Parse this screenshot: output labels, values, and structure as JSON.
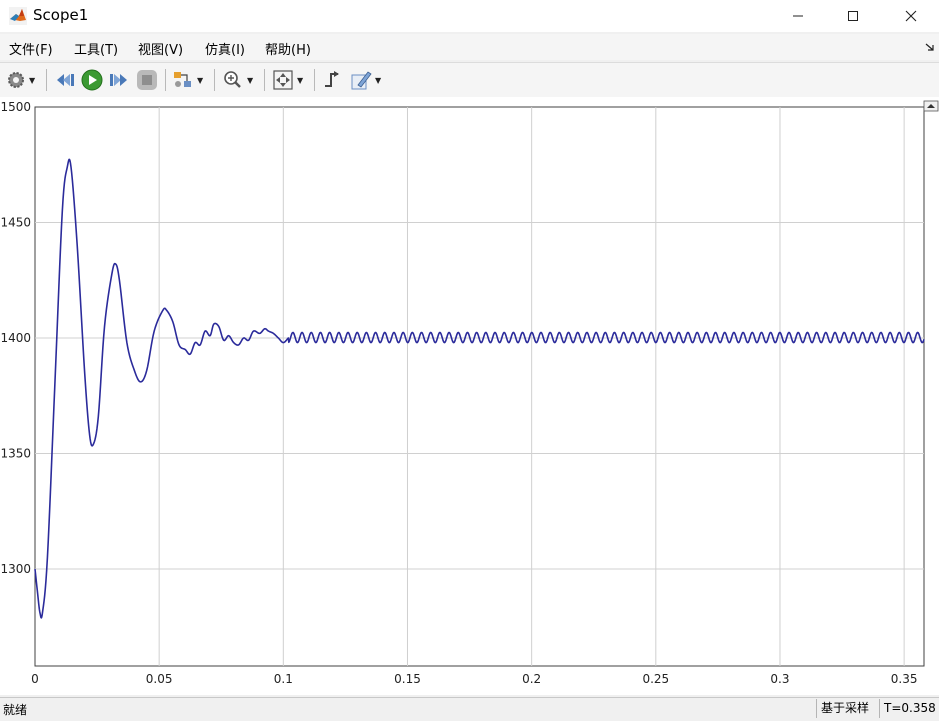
{
  "window": {
    "title": "Scope1"
  },
  "menu": {
    "items": [
      {
        "label": "文件(F)"
      },
      {
        "label": "工具(T)"
      },
      {
        "label": "视图(V)"
      },
      {
        "label": "仿真(I)"
      },
      {
        "label": "帮助(H)"
      }
    ]
  },
  "toolbar": {
    "icons": [
      "gear-icon",
      "step-back-icon",
      "run-icon",
      "step-forward-icon",
      "stop-icon",
      "signal-select-icon",
      "zoom-in-icon",
      "autoscale-icon",
      "triggers-icon",
      "style-icon"
    ]
  },
  "status": {
    "text": "就绪",
    "mode": "基于采样",
    "time": "T=0.358"
  },
  "colors": {
    "trace": "#2b2b9b",
    "grid": "#d0d0d0",
    "axes_bg": "#ffffff"
  },
  "chart_data": {
    "type": "line",
    "title": "",
    "xlabel": "",
    "ylabel": "",
    "xlim": [
      0,
      0.358
    ],
    "ylim": [
      1258,
      1500
    ],
    "xticks": [
      0,
      0.05,
      0.1,
      0.15,
      0.2,
      0.25,
      0.3,
      0.35
    ],
    "xtick_labels": [
      "0",
      "0.05",
      "0.1",
      "0.15",
      "0.2",
      "0.25",
      "0.3",
      "0.35"
    ],
    "yticks": [
      1300,
      1350,
      1400,
      1450,
      1500
    ],
    "ytick_labels": [
      "1300",
      "1350",
      "1400",
      "1450",
      "1500"
    ],
    "grid": true,
    "series": [
      {
        "x": [
          0,
          0.001,
          0.002,
          0.003,
          0.005,
          0.008,
          0.011,
          0.013,
          0.0145,
          0.017,
          0.02,
          0.022,
          0.0235,
          0.0255,
          0.028,
          0.031,
          0.0325,
          0.034,
          0.037,
          0.04,
          0.0425,
          0.045,
          0.048,
          0.0515,
          0.053,
          0.0555,
          0.058,
          0.0605,
          0.0625,
          0.0645,
          0.0665,
          0.0685,
          0.0705,
          0.072,
          0.074,
          0.076,
          0.078,
          0.08,
          0.082,
          0.084,
          0.086,
          0.088,
          0.0905,
          0.0925,
          0.094,
          0.096,
          0.098,
          0.1,
          0.102
        ],
        "y": [
          1300,
          1290,
          1281,
          1281,
          1305,
          1380,
          1455,
          1474,
          1474,
          1440,
          1385,
          1358,
          1354,
          1366,
          1405,
          1428,
          1432,
          1425,
          1398,
          1386,
          1381,
          1386,
          1403,
          1412,
          1412,
          1407,
          1397,
          1395,
          1393,
          1398,
          1397,
          1403,
          1401,
          1406,
          1405,
          1399,
          1401,
          1398,
          1397,
          1400,
          1399,
          1403,
          1402,
          1404,
          1403,
          1402,
          1400,
          1398,
          1400
        ],
        "ripple_after": 0.1,
        "ripple_mean": 1400.2,
        "ripple_amplitude": 2.2,
        "ripple_period": 0.0037
      }
    ]
  }
}
